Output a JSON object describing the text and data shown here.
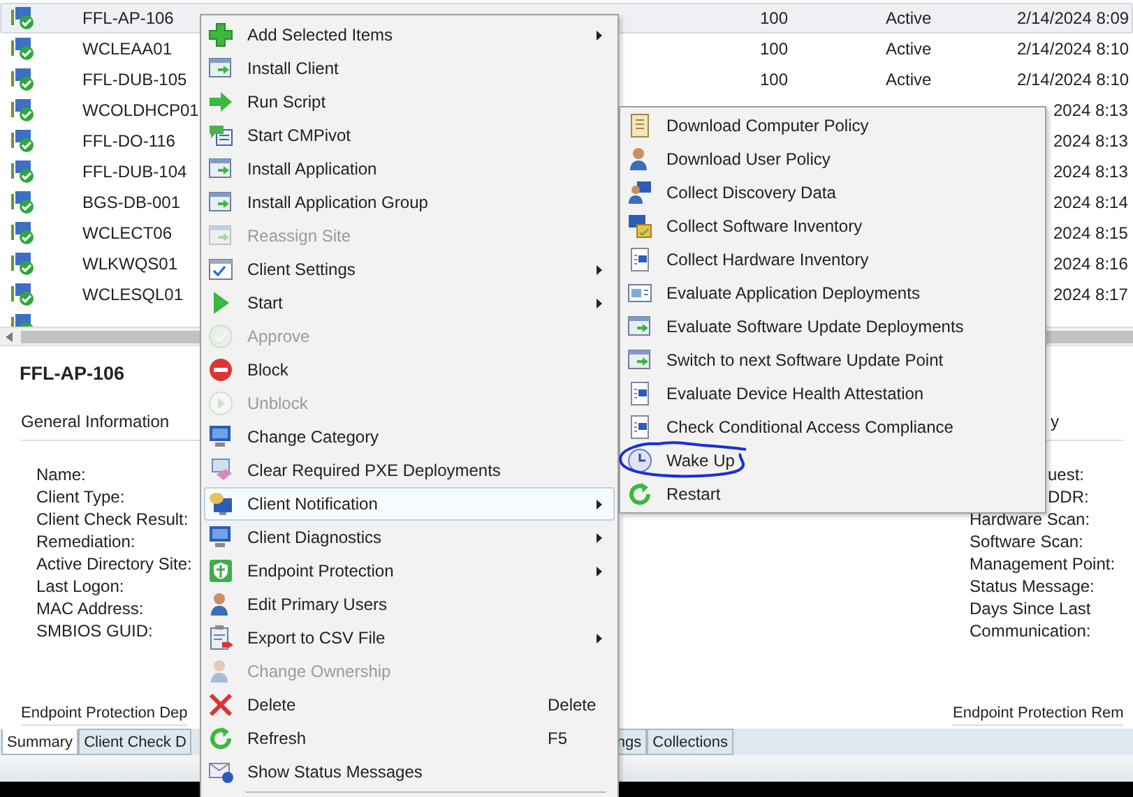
{
  "list": {
    "rows": [
      {
        "name": "FFL-AP-106",
        "selected": true,
        "column_2": "100",
        "status": "Active",
        "date": "2/14/2024 8:09"
      },
      {
        "name": "WCLEAA01",
        "selected": false,
        "column_2": "100",
        "status": "Active",
        "date": "2/14/2024 8:10"
      },
      {
        "name": "FFL-DUB-105",
        "selected": false,
        "column_2": "100",
        "status": "Active",
        "date": "2/14/2024 8:10"
      },
      {
        "name": "WCOLDHCP01",
        "selected": false,
        "date": "2024 8:13"
      },
      {
        "name": "FFL-DO-116",
        "selected": false,
        "date": "2024 8:13"
      },
      {
        "name": "FFL-DUB-104",
        "selected": false,
        "date": "2024 8:13"
      },
      {
        "name": "BGS-DB-001",
        "selected": false,
        "date": "2024 8:14"
      },
      {
        "name": "WCLECT06",
        "selected": false,
        "date": "2024 8:15"
      },
      {
        "name": "WLKWQS01",
        "selected": false,
        "date": "2024 8:16"
      },
      {
        "name": "WCLESQL01",
        "selected": false,
        "date": "2024 8:17"
      }
    ]
  },
  "details": {
    "title": "FFL-AP-106",
    "left": {
      "heading": "General Information",
      "labels": [
        "Name:",
        "Client Type:",
        "Client Check Result:",
        "Remediation:",
        "Active Directory Site:",
        "Last Logon:",
        "MAC Address:",
        "SMBIOS GUID:"
      ],
      "footer_heading": "Endpoint Protection Dep"
    },
    "right": {
      "heading": "y",
      "cut_labels": [
        "uest:",
        "DDR:"
      ],
      "labels": [
        "Hardware Scan:",
        "Software Scan:",
        "Management Point:",
        "Status Message:",
        "Days Since Last",
        "Communication:"
      ],
      "footer_heading": "Endpoint Protection Rem"
    }
  },
  "tabs": [
    {
      "label": "Summary",
      "selected": true
    },
    {
      "label": "Client Check D",
      "selected": false
    },
    {
      "label": "ngs",
      "selected": false
    },
    {
      "label": "Collections",
      "selected": false
    }
  ],
  "context_menu": {
    "items": [
      {
        "label": "Add Selected Items",
        "disabled": false,
        "has_submenu": true,
        "selected": false
      },
      {
        "label": "Install Client",
        "disabled": false,
        "has_submenu": false,
        "selected": false
      },
      {
        "label": "Run Script",
        "disabled": false,
        "has_submenu": false,
        "selected": false
      },
      {
        "label": "Start CMPivot",
        "disabled": false,
        "has_submenu": false,
        "selected": false
      },
      {
        "label": "Install Application",
        "disabled": false,
        "has_submenu": false,
        "selected": false
      },
      {
        "label": "Install Application Group",
        "disabled": false,
        "has_submenu": false,
        "selected": false
      },
      {
        "label": "Reassign Site",
        "disabled": true,
        "has_submenu": false,
        "selected": false
      },
      {
        "label": "Client Settings",
        "disabled": false,
        "has_submenu": true,
        "selected": false
      },
      {
        "label": "Start",
        "disabled": false,
        "has_submenu": true,
        "selected": false
      },
      {
        "label": "Approve",
        "disabled": true,
        "has_submenu": false,
        "selected": false
      },
      {
        "label": "Block",
        "disabled": false,
        "has_submenu": false,
        "selected": false
      },
      {
        "label": "Unblock",
        "disabled": true,
        "has_submenu": false,
        "selected": false
      },
      {
        "label": "Change Category",
        "disabled": false,
        "has_submenu": false,
        "selected": false
      },
      {
        "label": "Clear Required PXE Deployments",
        "disabled": false,
        "has_submenu": false,
        "selected": false
      },
      {
        "label": "Client Notification",
        "disabled": false,
        "has_submenu": true,
        "selected": true
      },
      {
        "label": "Client Diagnostics",
        "disabled": false,
        "has_submenu": true,
        "selected": false
      },
      {
        "label": "Endpoint Protection",
        "disabled": false,
        "has_submenu": true,
        "selected": false
      },
      {
        "label": "Edit Primary Users",
        "disabled": false,
        "has_submenu": false,
        "selected": false
      },
      {
        "label": "Export to CSV File",
        "disabled": false,
        "has_submenu": true,
        "selected": false
      },
      {
        "label": "Change Ownership",
        "disabled": true,
        "has_submenu": false,
        "selected": false
      },
      {
        "label": "Delete",
        "disabled": false,
        "has_submenu": false,
        "selected": false,
        "shortcut": "Delete"
      },
      {
        "label": "Refresh",
        "disabled": false,
        "has_submenu": false,
        "selected": false,
        "shortcut": "F5"
      },
      {
        "label": "Show Status Messages",
        "disabled": false,
        "has_submenu": false,
        "selected": false
      }
    ]
  },
  "submenu": {
    "items": [
      {
        "label": "Download Computer Policy"
      },
      {
        "label": "Download User Policy"
      },
      {
        "label": "Collect Discovery Data"
      },
      {
        "label": "Collect Software Inventory"
      },
      {
        "label": "Collect Hardware Inventory"
      },
      {
        "label": "Evaluate Application Deployments"
      },
      {
        "label": "Evaluate Software Update Deployments"
      },
      {
        "label": "Switch to next Software Update Point"
      },
      {
        "label": "Evaluate Device Health Attestation"
      },
      {
        "label": "Check Conditional Access Compliance"
      },
      {
        "label": "Wake Up"
      },
      {
        "label": "Restart"
      }
    ]
  }
}
